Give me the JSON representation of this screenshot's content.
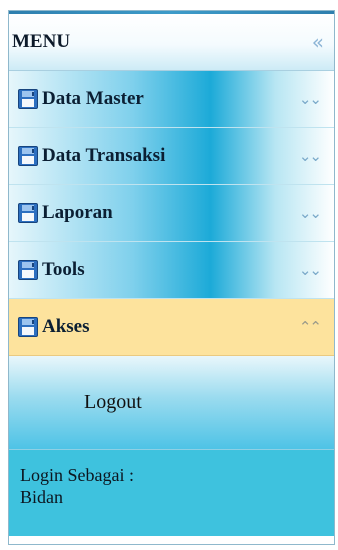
{
  "menu": {
    "title": "MENU",
    "collapse_icon": "double-chevron-left-icon",
    "items": [
      {
        "label": "Data Master",
        "icon": "floppy-disk-icon",
        "expanded": false
      },
      {
        "label": "Data Transaksi",
        "icon": "floppy-disk-icon",
        "expanded": false
      },
      {
        "label": "Laporan",
        "icon": "floppy-disk-icon",
        "expanded": false
      },
      {
        "label": "Tools",
        "icon": "floppy-disk-icon",
        "expanded": false
      },
      {
        "label": "Akses",
        "icon": "floppy-disk-icon",
        "expanded": true
      }
    ],
    "submenu": {
      "logout_label": "Logout"
    },
    "footer": {
      "line1": "Login Sebagai :",
      "line2": "Bidan"
    }
  },
  "colors": {
    "active_item": "#fde39d",
    "accent_blue": "#1caad8",
    "footer_bg": "#3ec2de",
    "header_bar": "#2f7fae"
  }
}
